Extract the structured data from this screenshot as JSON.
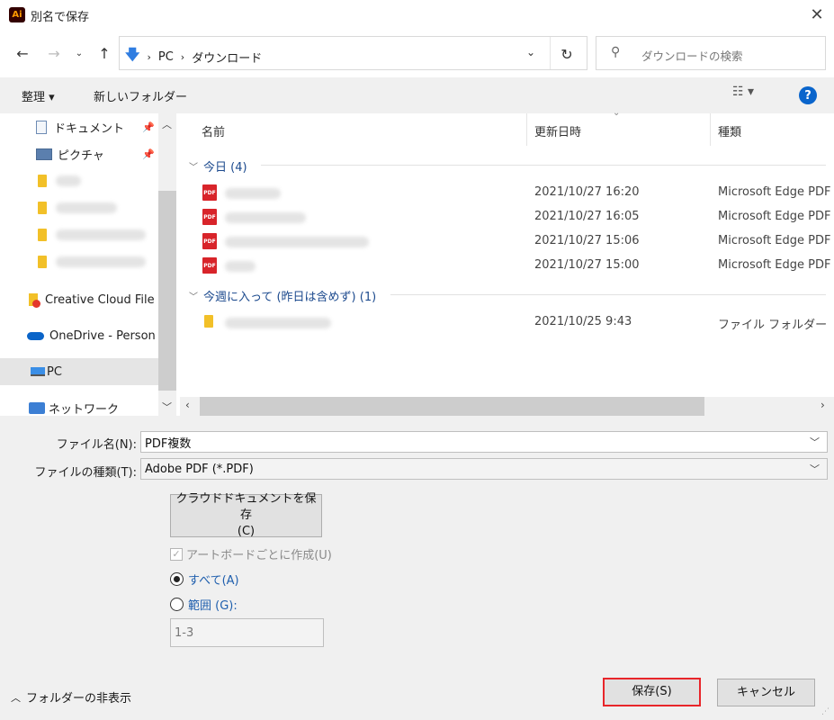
{
  "window": {
    "app_badge": "Ai",
    "title": "別名で保存",
    "close_glyph": "✕"
  },
  "address": {
    "crumbs": [
      "PC",
      "ダウンロード"
    ],
    "search_placeholder": "ダウンロードの検索"
  },
  "toolbar": {
    "organize": "整理 ▾",
    "new_folder": "新しいフォルダー",
    "help": "?"
  },
  "sidebar": {
    "items": [
      {
        "label": "ドキュメント",
        "icon": "document-icon",
        "pinned": true
      },
      {
        "label": "ピクチャ",
        "icon": "pictures-icon",
        "pinned": true
      },
      {
        "label": "",
        "icon": "folder-icon"
      },
      {
        "label": "",
        "icon": "folder-icon"
      },
      {
        "label": "",
        "icon": "folder-icon"
      },
      {
        "label": "",
        "icon": "folder-icon"
      },
      {
        "label": "Creative Cloud File",
        "icon": "creative-cloud-icon"
      },
      {
        "label": "OneDrive - Person",
        "icon": "onedrive-icon"
      },
      {
        "label": "PC",
        "icon": "pc-icon",
        "selected": true
      },
      {
        "label": "ネットワーク",
        "icon": "network-icon"
      }
    ]
  },
  "columns": {
    "name": "名前",
    "date": "更新日時",
    "type": "種類"
  },
  "groups": [
    {
      "label": "今日 (4)",
      "files": [
        {
          "icon": "pdf-icon",
          "date": "2021/10/27 16:20",
          "type": "Microsoft Edge PDF"
        },
        {
          "icon": "pdf-icon",
          "date": "2021/10/27 16:05",
          "type": "Microsoft Edge PDF"
        },
        {
          "icon": "pdf-icon",
          "date": "2021/10/27 15:06",
          "type": "Microsoft Edge PDF"
        },
        {
          "icon": "pdf-icon",
          "date": "2021/10/27 15:00",
          "type": "Microsoft Edge PDF"
        }
      ]
    },
    {
      "label": "今週に入って (昨日は含めず) (1)",
      "files": [
        {
          "icon": "folder-icon",
          "date": "2021/10/25 9:43",
          "type": "ファイル フォルダー"
        }
      ]
    }
  ],
  "form": {
    "filename_label": "ファイル名(N):",
    "filename_value": "PDF複数",
    "filetype_label": "ファイルの種類(T):",
    "filetype_value": "Adobe PDF (*.PDF)",
    "cloud_button": "クラウドドキュメントを保存\n(C)",
    "cloud_line1": "クラウドドキュメントを保存",
    "cloud_line2": "(C)",
    "artboards_label": "アートボードごとに作成(U)",
    "radio_all": "すべて(A)",
    "radio_range": "範囲 (G):",
    "range_value": "1-3"
  },
  "footer": {
    "hide_folders": "フォルダーの非表示",
    "save": "保存(S)",
    "cancel": "キャンセル"
  },
  "colors": {
    "accent": "#0a65cc",
    "save_border": "#e8252a",
    "link": "#1f5fae"
  }
}
